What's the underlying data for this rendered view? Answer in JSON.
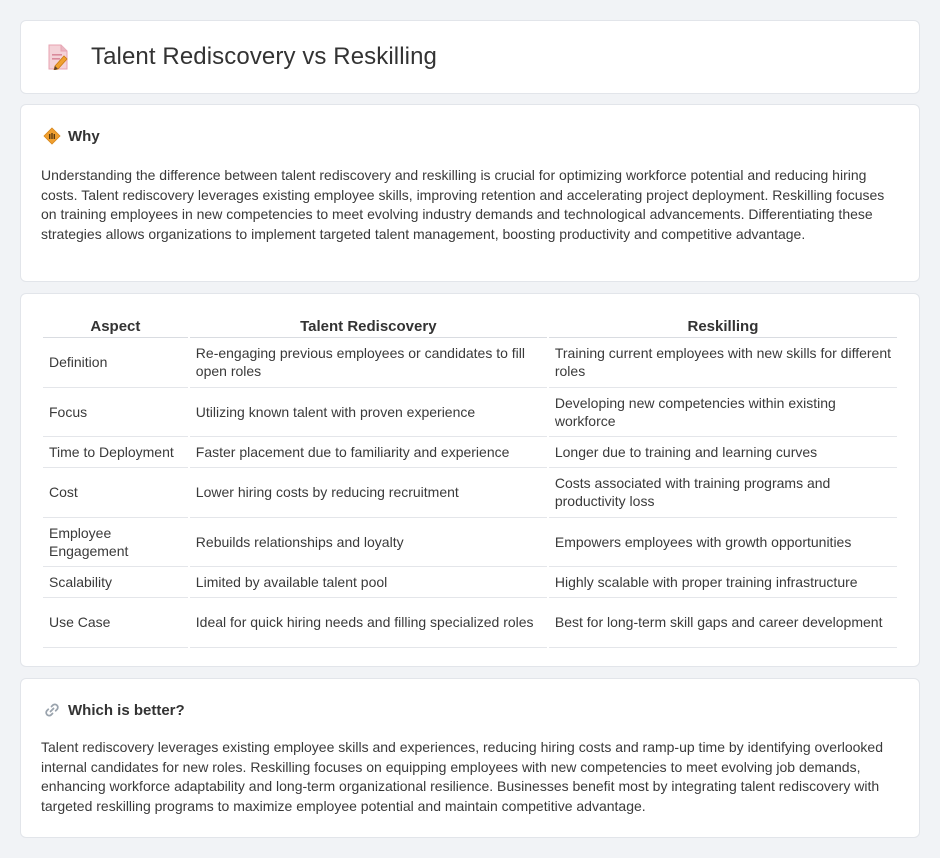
{
  "header": {
    "title": "Talent Rediscovery vs Reskilling",
    "icon": "document-pencil-icon"
  },
  "why": {
    "heading": "Why",
    "icon": "diamond-sign-icon",
    "text": "Understanding the difference between talent rediscovery and reskilling is crucial for optimizing workforce potential and reducing hiring costs. Talent rediscovery leverages existing employee skills, improving retention and accelerating project deployment. Reskilling focuses on training employees in new competencies to meet evolving industry demands and technological advancements. Differentiating these strategies allows organizations to implement targeted talent management, boosting productivity and competitive advantage."
  },
  "comparison": {
    "columns": [
      "Aspect",
      "Talent Rediscovery",
      "Reskilling"
    ],
    "rows": [
      [
        "Definition",
        "Re-engaging previous employees or candidates to fill open roles",
        "Training current employees with new skills for different roles"
      ],
      [
        "Focus",
        "Utilizing known talent with proven experience",
        "Developing new competencies within existing workforce"
      ],
      [
        "Time to Deployment",
        "Faster placement due to familiarity and experience",
        "Longer due to training and learning curves"
      ],
      [
        "Cost",
        "Lower hiring costs by reducing recruitment",
        "Costs associated with training programs and productivity loss"
      ],
      [
        "Employee Engagement",
        "Rebuilds relationships and loyalty",
        "Empowers employees with growth opportunities"
      ],
      [
        "Scalability",
        "Limited by available talent pool",
        "Highly scalable with proper training infrastructure"
      ],
      [
        "Use Case",
        "Ideal for quick hiring needs and filling specialized roles",
        "Best for long-term skill gaps and career development"
      ]
    ]
  },
  "better": {
    "heading": "Which is better?",
    "icon": "link-icon",
    "text": "Talent rediscovery leverages existing employee skills and experiences, reducing hiring costs and ramp-up time by identifying overlooked internal candidates for new roles. Reskilling focuses on equipping employees with new competencies to meet evolving job demands, enhancing workforce adaptability and long-term organizational resilience. Businesses benefit most by integrating talent rediscovery with targeted reskilling programs to maximize employee potential and maintain competitive advantage."
  },
  "colors": {
    "background": "#f1f3f6",
    "card": "#ffffff",
    "accent_orange": "#f0a030",
    "icon_pink": "#e8607a"
  }
}
